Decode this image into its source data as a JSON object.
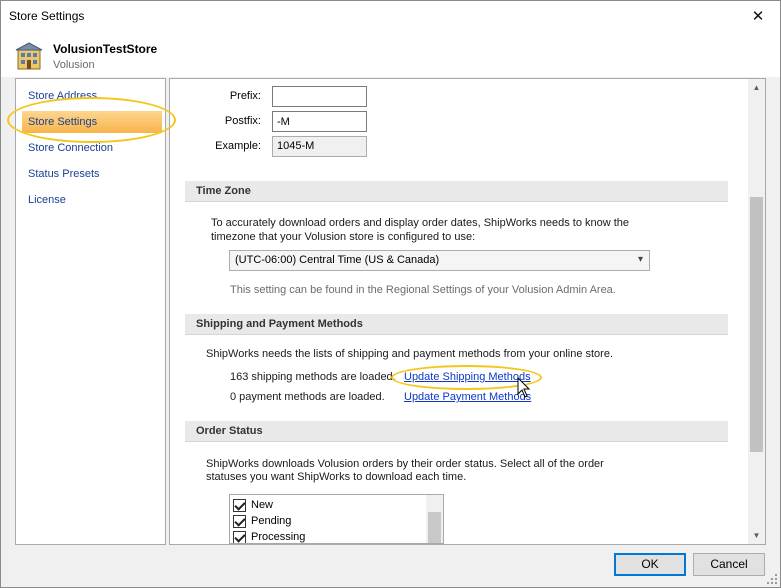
{
  "window": {
    "title": "Store Settings",
    "close_glyph": "✕"
  },
  "store": {
    "name": "VolusionTestStore",
    "platform": "Volusion",
    "icon": "store-building-icon"
  },
  "sidebar": {
    "items": [
      {
        "label": "Store Address",
        "selected": false
      },
      {
        "label": "Store Settings",
        "selected": true
      },
      {
        "label": "Store Connection",
        "selected": false
      },
      {
        "label": "Status Presets",
        "selected": false
      },
      {
        "label": "License",
        "selected": false
      }
    ]
  },
  "order_number": {
    "prefix_label": "Prefix:",
    "prefix_value": "",
    "postfix_label": "Postfix:",
    "postfix_value": "-M",
    "example_label": "Example:",
    "example_value": "1045-M"
  },
  "time_zone": {
    "header": "Time Zone",
    "description_line1": "To accurately download orders and display order dates, ShipWorks needs to know the",
    "description_line2": "timezone that your Volusion store is configured to use:",
    "selected": "(UTC-06:00) Central Time (US & Canada)",
    "hint": "This setting can be found in the Regional Settings of your Volusion Admin Area."
  },
  "shipping_payment": {
    "header": "Shipping and Payment Methods",
    "description": "ShipWorks needs the lists of shipping and payment methods from your online store.",
    "shipping_status": "163 shipping methods are loaded.",
    "shipping_link": "Update Shipping Methods",
    "payment_status": "0 payment methods are loaded.",
    "payment_link": "Update Payment Methods"
  },
  "order_status": {
    "header": "Order Status",
    "description_line1": "ShipWorks downloads Volusion orders by their order status. Select all of the order",
    "description_line2": "statuses you want ShipWorks to download each time.",
    "statuses": [
      {
        "label": "New",
        "checked": true
      },
      {
        "label": "Pending",
        "checked": true
      },
      {
        "label": "Processing",
        "checked": true
      }
    ]
  },
  "buttons": {
    "ok": "OK",
    "cancel": "Cancel"
  },
  "colors": {
    "highlight_ring": "#f5c518",
    "link": "#0d38c8",
    "selected_item": "#f8b449"
  }
}
